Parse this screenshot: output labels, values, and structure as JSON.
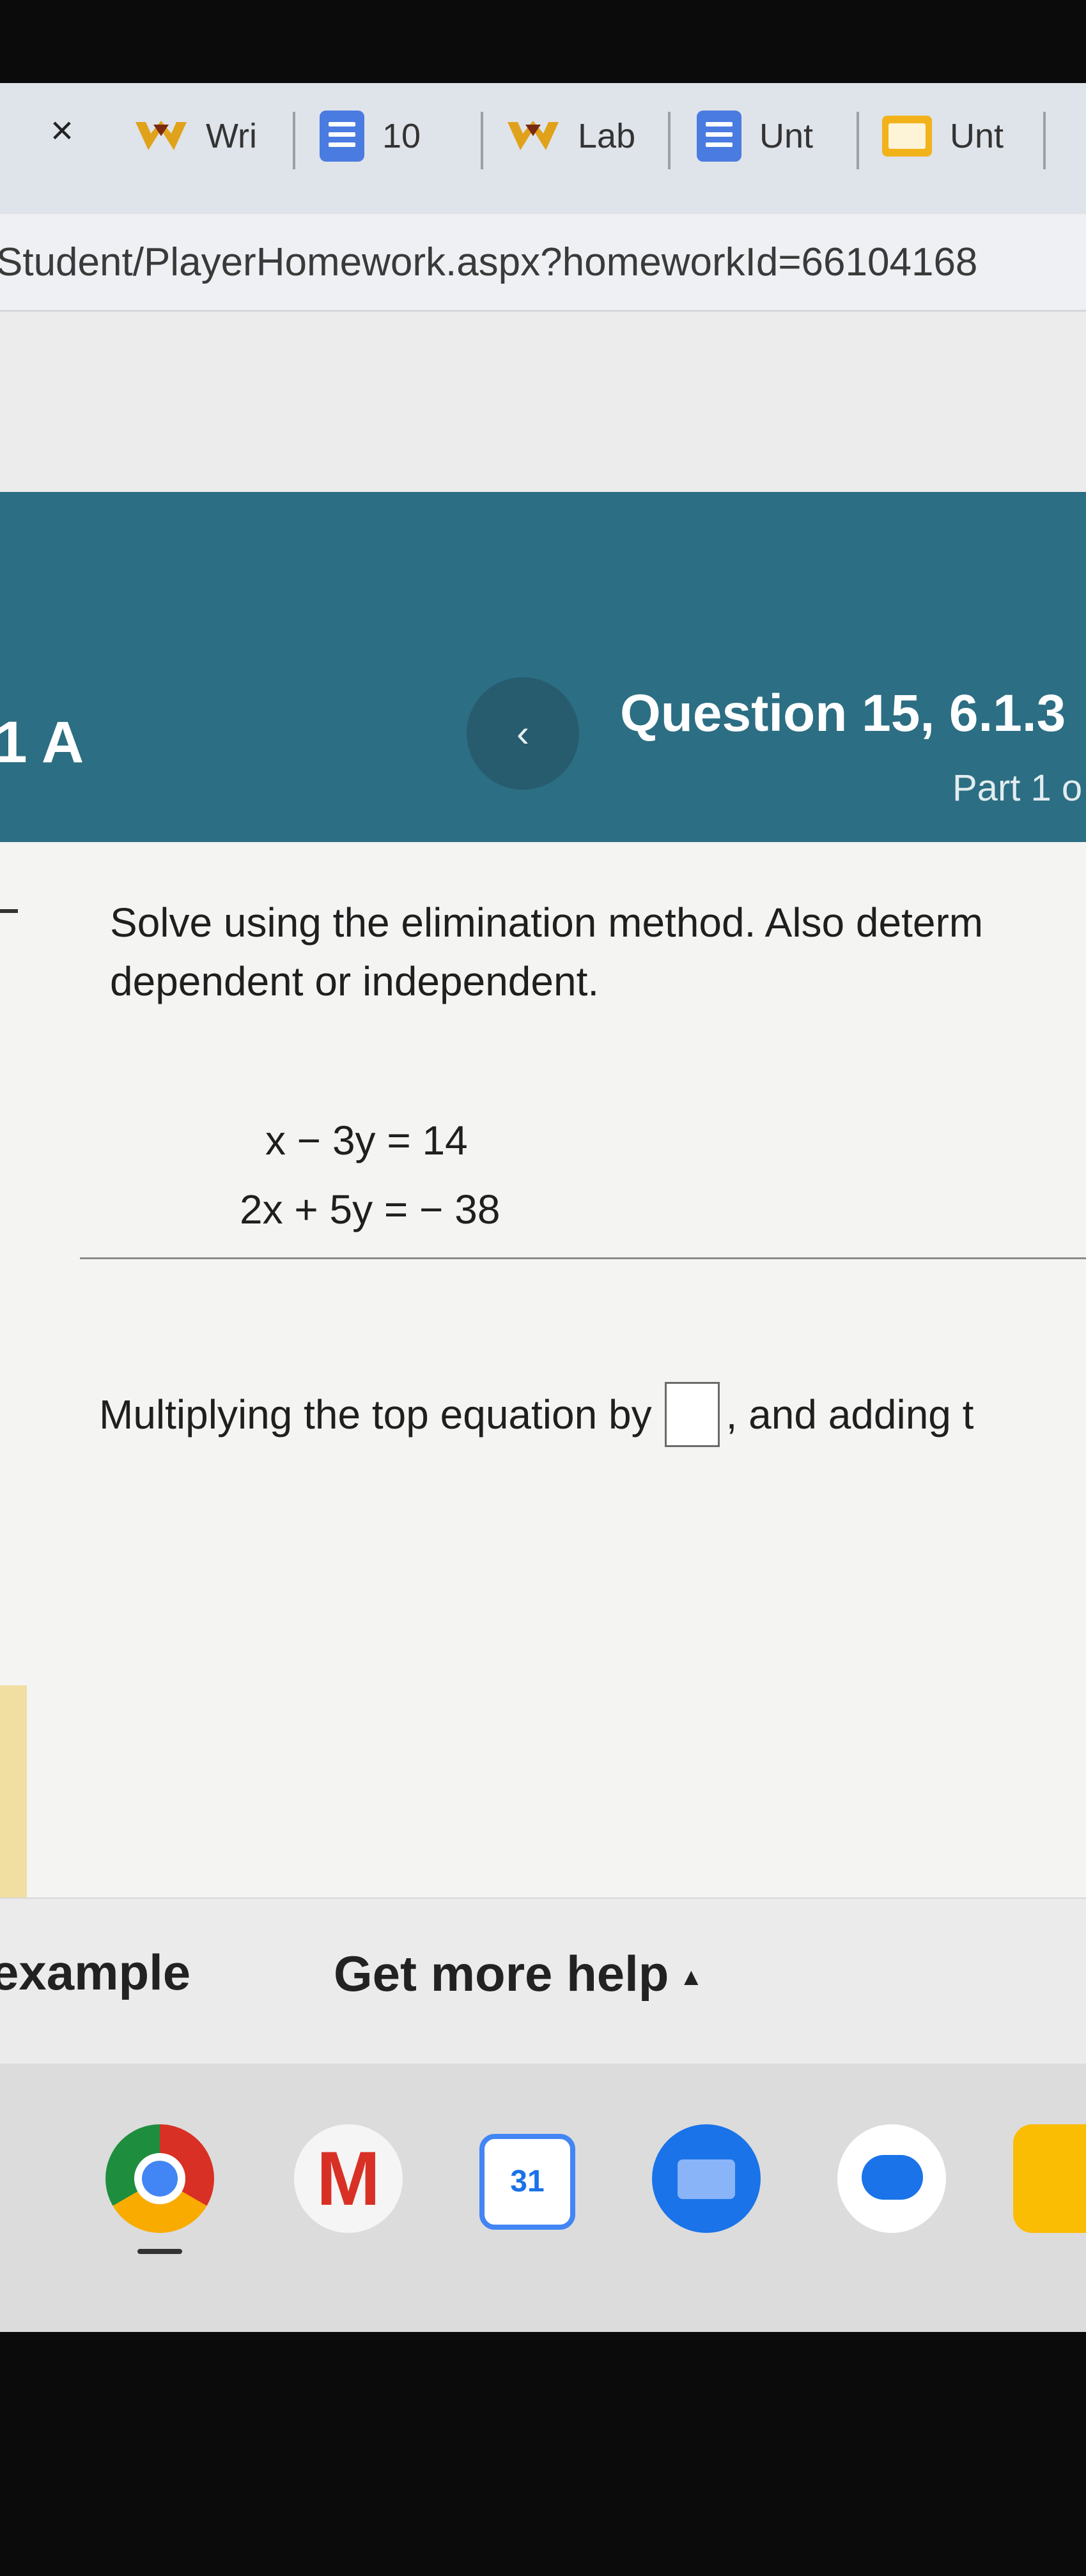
{
  "browser": {
    "tabs": [
      {
        "label": "Wri",
        "icon": "w-logo-icon"
      },
      {
        "label": "10",
        "icon": "docs-icon"
      },
      {
        "label": "Lab",
        "icon": "w-logo-icon"
      },
      {
        "label": "Unt",
        "icon": "docs-icon"
      },
      {
        "label": "Unt",
        "icon": "slides-icon"
      }
    ],
    "close_symbol": "×",
    "url": "Student/PlayerHomework.aspx?homeworkId=66104168"
  },
  "header": {
    "section_label": ".1 A",
    "prev_symbol": "‹",
    "question_title": "Question 15, 6.1.3",
    "part_label": "Part 1 o"
  },
  "problem": {
    "instruction_line1": "Solve using the elimination method. Also determ",
    "instruction_line2": "dependent or independent.",
    "equation1": "x − 3y  =  14",
    "equation2": "2x + 5y  =  − 38",
    "prompt_before": "Multiplying the top equation by",
    "prompt_after": ", and adding t"
  },
  "help": {
    "example_label": "example",
    "more_help_label": "Get more help",
    "more_help_caret": "▲"
  },
  "shelf": {
    "calendar_day": "31",
    "gmail_letter": "M"
  }
}
